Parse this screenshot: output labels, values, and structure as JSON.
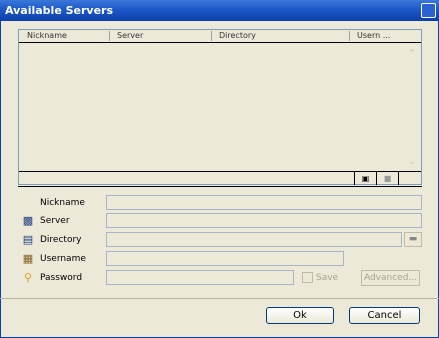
{
  "window": {
    "title": "Available Servers"
  },
  "list": {
    "columns": [
      "Nickname",
      "Server",
      "Directory",
      "Usern ..."
    ]
  },
  "form": {
    "nickname_label": "Nickname",
    "server_label": "Server",
    "directory_label": "Directory",
    "username_label": "Username",
    "password_label": "Password",
    "save_label": "Save",
    "advanced_label": "Advanced..."
  },
  "buttons": {
    "ok_label": "Ok",
    "cancel_label": "Cancel"
  },
  "icons": {
    "server": "server-icon",
    "directory": "book-icon",
    "username": "user-icon",
    "password": "key-icon",
    "new": "new-document-icon",
    "delete": "trash-icon",
    "browse": "folder-icon"
  },
  "colors": {
    "titlebar": "#1c58c8",
    "dialog_bg": "#ece9d8",
    "button_border": "#003c74"
  }
}
